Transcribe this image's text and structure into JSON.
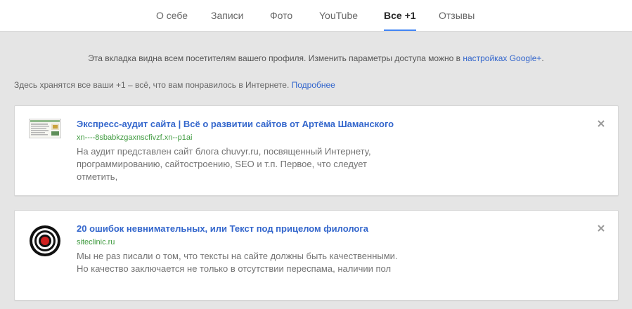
{
  "tabs": [
    {
      "label": "О себе"
    },
    {
      "label": "Записи"
    },
    {
      "label": "Фото"
    },
    {
      "label": "YouTube"
    },
    {
      "label": "Все +1"
    },
    {
      "label": "Отзывы"
    }
  ],
  "active_tab": "Все +1",
  "notice": {
    "text": "Эта вкладка видна всем посетителям вашего профиля. Изменить параметры доступа можно в ",
    "link": "настройках Google+",
    "suffix": "."
  },
  "intro": {
    "text": "Здесь хранятся все ваши +1 – всё, что вам понравилось в Интернете. ",
    "link": "Подробнее"
  },
  "items": [
    {
      "title": "Экспресс-аудит сайта | Всё о развитии сайтов от Артёма Шаманского",
      "url": "xn----8sbabkzgaxnscfivzf.xn--p1ai",
      "snippet": "На аудит представлен сайт блога chuvyr.ru, посвященный Интернету, программированию, сайтостроению, SEO и т.п. Первое, что следует отметить,",
      "thumb_icon": "site-screenshot-thumbnail"
    },
    {
      "title": "20 ошибок невнимательных, или Текст под прицелом филолога",
      "url": "siteclinic.ru",
      "snippet": "Мы не раз писали о том, что тексты на сайте должны быть качественными. Но качество заключается не только в отсутствии переспама, наличии пол",
      "thumb_icon": "target-icon"
    }
  ],
  "colors": {
    "link": "#3366cc",
    "url": "#3e9a3e",
    "active_tab_underline": "#4285f4",
    "page_bg": "#e5e5e5"
  }
}
